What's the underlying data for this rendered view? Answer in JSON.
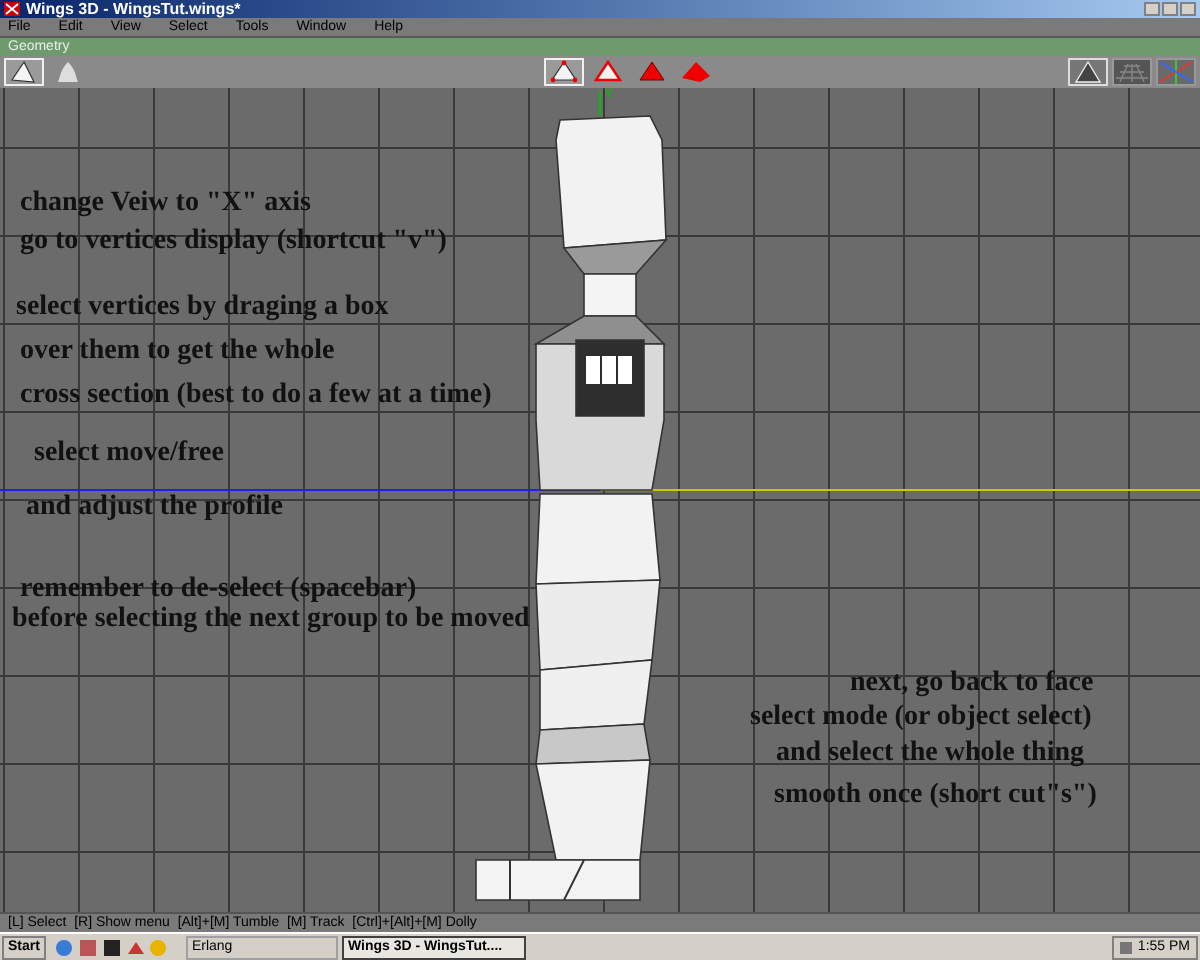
{
  "window": {
    "title": "Wings 3D - WingsTut.wings*"
  },
  "menu": [
    "File",
    "Edit",
    "View",
    "Select",
    "Tools",
    "Window",
    "Help"
  ],
  "geometry_bar": {
    "title": "Geometry"
  },
  "toolbar": {
    "left_buttons": [
      {
        "selected": true
      },
      {
        "selected": false
      }
    ],
    "select_modes": [
      {
        "kind": "vertex",
        "selected": true
      },
      {
        "kind": "edge",
        "selected": false
      },
      {
        "kind": "face",
        "selected": false
      },
      {
        "kind": "body",
        "selected": false
      }
    ]
  },
  "viewport": {
    "axis_label": "Y",
    "annotations": [
      "change Veiw to \"X\" axis",
      "go to vertices display (shortcut \"v\")",
      "select vertices by draging a box",
      "over them to get the whole",
      "cross section (best to do a few at a time)",
      "select move/free",
      "and adjust the profile",
      "remember to de-select (spacebar)",
      "before selecting the next group to be moved",
      "next, go back to face",
      "select mode (or object select)",
      "and select the whole thing",
      "smooth once (short cut\"s\")"
    ]
  },
  "status_bar": "[L] Select  [R] Show menu  [Alt]+[M] Tumble  [M] Track  [Ctrl]+[Alt]+[M] Dolly",
  "taskbar": {
    "start": "Start",
    "tasks": [
      {
        "label": "Erlang",
        "selected": false
      },
      {
        "label": "Wings 3D - WingsTut....",
        "selected": true
      }
    ],
    "clock": "1:55 PM"
  }
}
